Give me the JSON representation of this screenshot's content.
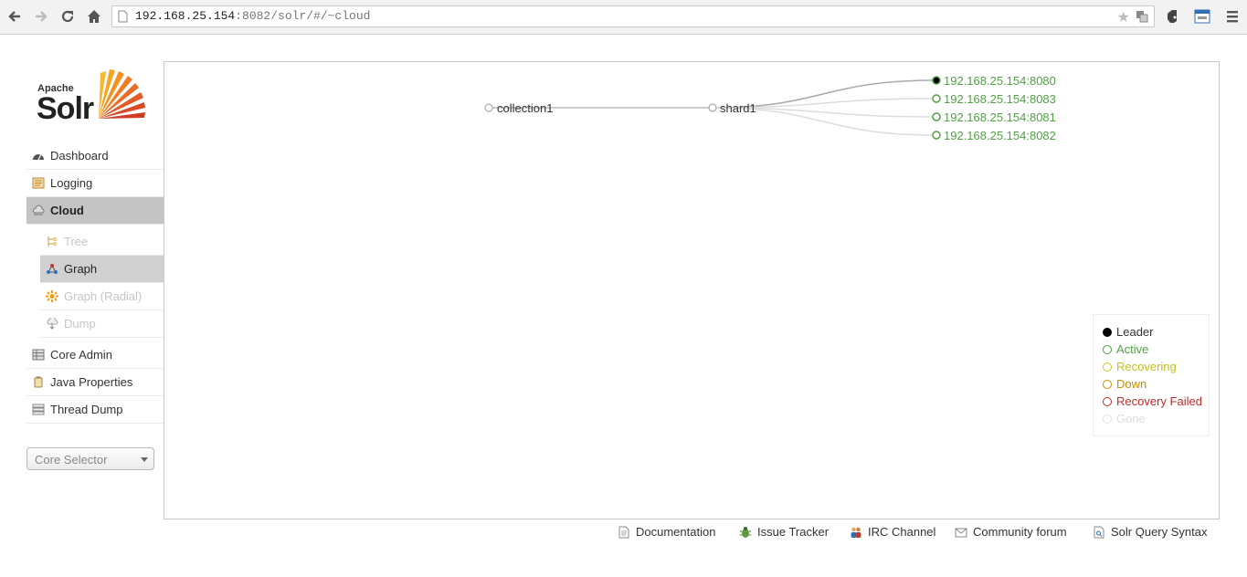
{
  "browser": {
    "url_host": "192.168.25.154",
    "url_rest": ":8082/solr/#/~cloud"
  },
  "logo": {
    "apache": "Apache",
    "solr": "Solr"
  },
  "sidebar": {
    "items": [
      {
        "label": "Dashboard",
        "icon": "dashboard-icon"
      },
      {
        "label": "Logging",
        "icon": "logging-icon"
      },
      {
        "label": "Cloud",
        "icon": "cloud-icon"
      }
    ],
    "cloud_sub": [
      {
        "label": "Tree",
        "icon": "tree-icon"
      },
      {
        "label": "Graph",
        "icon": "graph-icon"
      },
      {
        "label": "Graph (Radial)",
        "icon": "graph-radial-icon"
      },
      {
        "label": "Dump",
        "icon": "dump-icon"
      }
    ],
    "more": [
      {
        "label": "Core Admin",
        "icon": "core-admin-icon"
      },
      {
        "label": "Java Properties",
        "icon": "java-properties-icon"
      },
      {
        "label": "Thread Dump",
        "icon": "thread-dump-icon"
      }
    ],
    "core_selector": "Core Selector"
  },
  "graph": {
    "collection": "collection1",
    "shard": "shard1",
    "replicas": [
      {
        "name": "192.168.25.154:8080",
        "state": "Leader"
      },
      {
        "name": "192.168.25.154:8083",
        "state": "Active"
      },
      {
        "name": "192.168.25.154:8081",
        "state": "Active"
      },
      {
        "name": "192.168.25.154:8082",
        "state": "Active"
      }
    ]
  },
  "legend": [
    {
      "label": "Leader",
      "color": "#000000"
    },
    {
      "label": "Active",
      "color": "#53a047"
    },
    {
      "label": "Recovering",
      "color": "#cccc1a"
    },
    {
      "label": "Down",
      "color": "#c48f00"
    },
    {
      "label": "Recovery Failed",
      "color": "#c12d2d"
    },
    {
      "label": "Gone",
      "color": "#e0e0e0"
    }
  ],
  "footer": [
    {
      "label": "Documentation",
      "icon": "documentation-icon"
    },
    {
      "label": "Issue Tracker",
      "icon": "bug-icon"
    },
    {
      "label": "IRC Channel",
      "icon": "irc-icon"
    },
    {
      "label": "Community forum",
      "icon": "mail-icon"
    },
    {
      "label": "Solr Query Syntax",
      "icon": "query-syntax-icon"
    }
  ]
}
